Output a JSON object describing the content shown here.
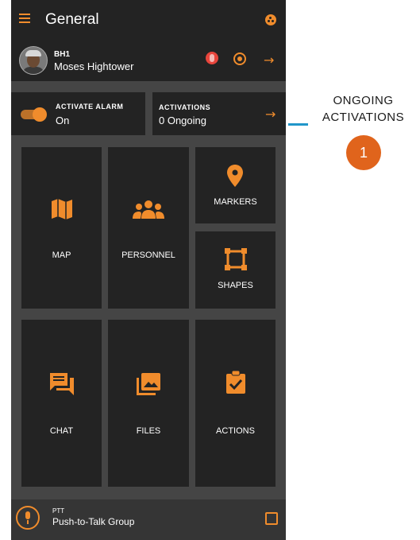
{
  "header": {
    "title": "General"
  },
  "user": {
    "callsign": "BH1",
    "name": "Moses Hightower"
  },
  "alarm": {
    "label": "ACTIVATE ALARM",
    "state": "On"
  },
  "activations": {
    "label": "ACTIVATIONS",
    "value": "0 Ongoing"
  },
  "tiles": {
    "map": "MAP",
    "personnel": "PERSONNEL",
    "markers": "MARKERS",
    "shapes": "SHAPES",
    "chat": "CHAT",
    "files": "FILES",
    "actions": "ACTIONS"
  },
  "ptt": {
    "small_label": "PTT",
    "group": "Push-to-Talk Group"
  },
  "callout": {
    "line1": "ONGOING",
    "line2": "ACTIVATIONS",
    "number": "1"
  },
  "colors": {
    "accent": "#f08c2c",
    "tile": "#232323",
    "background": "#454545",
    "callout_line": "#2196c9",
    "callout_badge": "#e0641c"
  },
  "icons": [
    "menu-icon",
    "status-icon",
    "medal-icon",
    "locate-icon",
    "arrow-right-icon",
    "map-icon",
    "personnel-icon",
    "marker-icon",
    "shapes-icon",
    "chat-icon",
    "files-icon",
    "actions-icon",
    "mic-icon",
    "external-link-icon"
  ]
}
